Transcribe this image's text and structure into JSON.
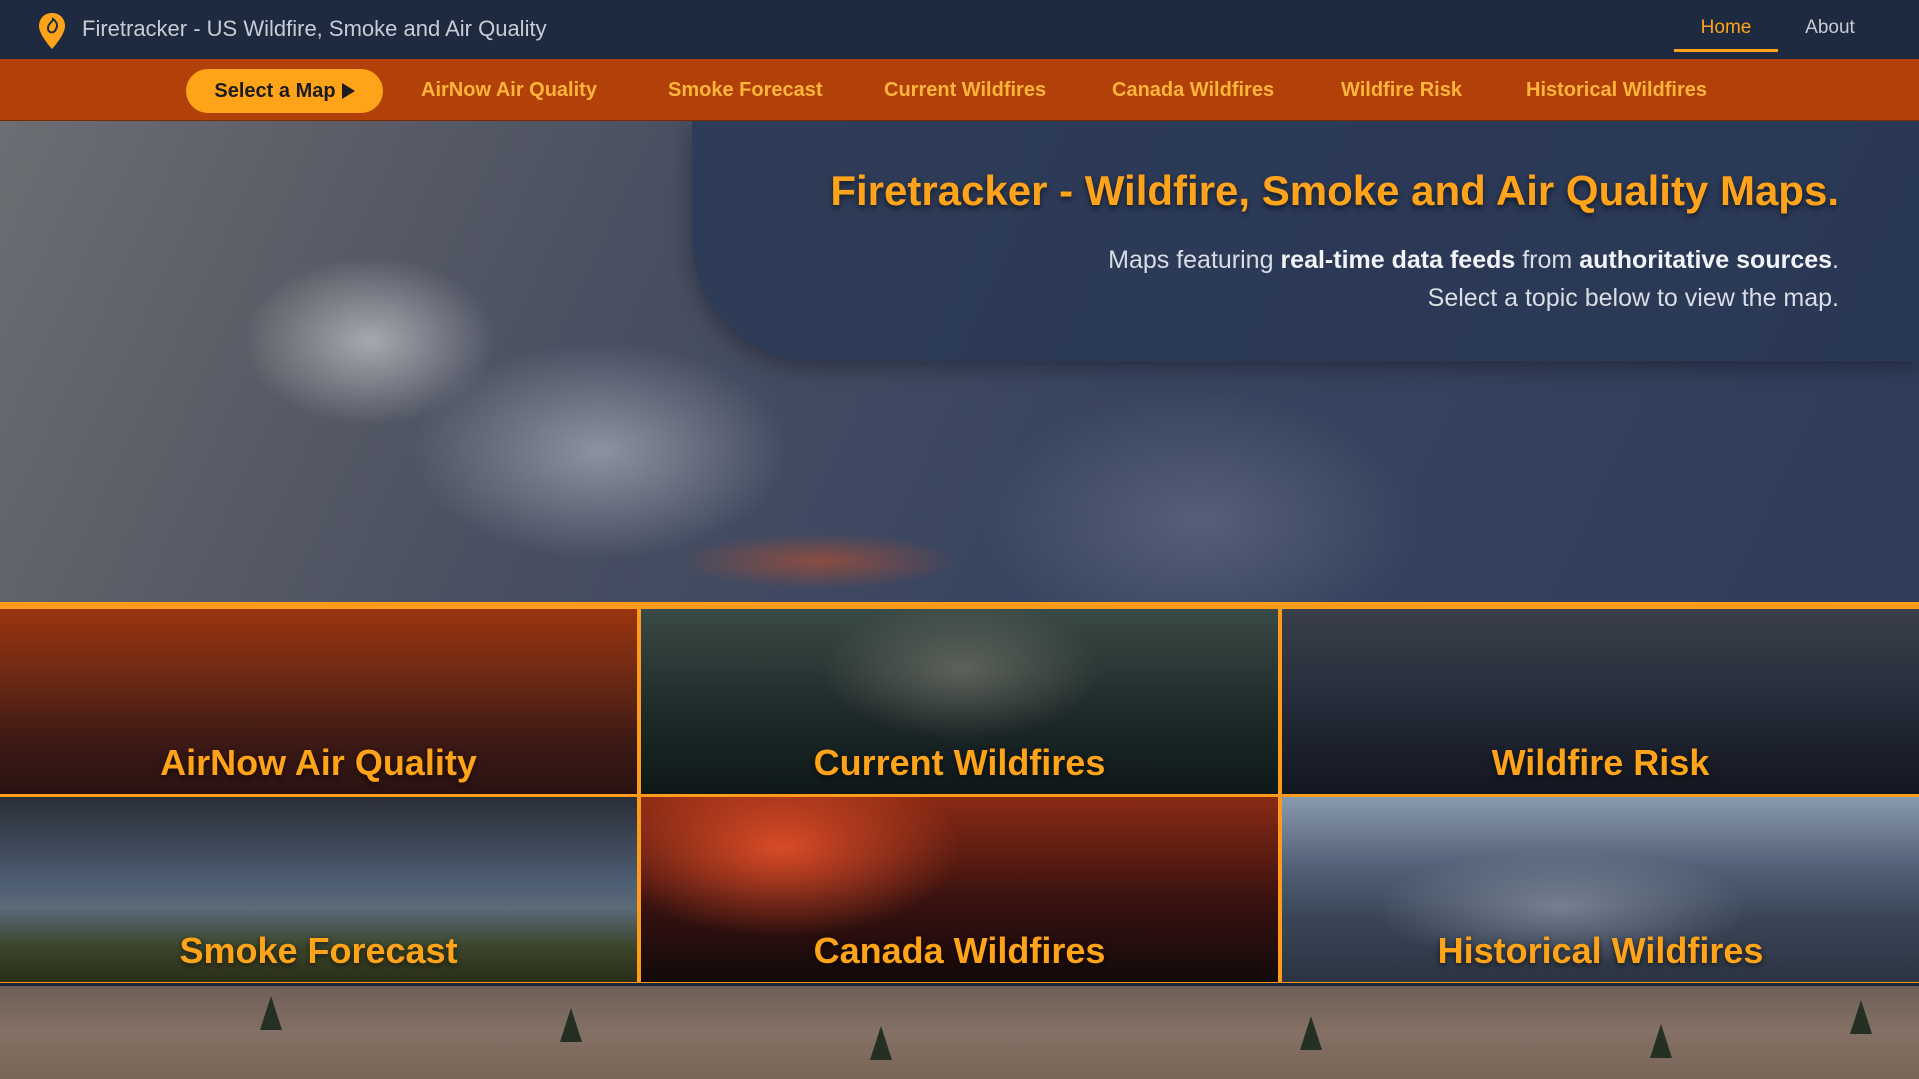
{
  "header": {
    "title": "Firetracker - US Wildfire, Smoke and Air Quality",
    "logo_icon": "flame-pin-icon",
    "nav": [
      {
        "label": "Home",
        "active": true
      },
      {
        "label": "About",
        "active": false
      }
    ]
  },
  "map_nav": {
    "select_label": "Select a Map",
    "links": [
      "AirNow Air Quality",
      "Smoke Forecast",
      "Current Wildfires",
      "Canada Wildfires",
      "Wildfire Risk",
      "Historical Wildfires"
    ]
  },
  "hero": {
    "title": "Firetracker - Wildfire, Smoke and Air Quality Maps.",
    "sub_prefix": "Maps featuring ",
    "sub_bold1": "real-time data feeds",
    "sub_mid": " from ",
    "sub_bold2": "authoritative sources",
    "sub_suffix": ".",
    "sub_line2": "Select a topic below to view the map."
  },
  "tiles": [
    {
      "label": "AirNow Air Quality"
    },
    {
      "label": "Current Wildfires"
    },
    {
      "label": "Wildfire Risk"
    },
    {
      "label": "Smoke Forecast"
    },
    {
      "label": "Canada Wildfires"
    },
    {
      "label": "Historical Wildfires"
    }
  ],
  "colors": {
    "accent": "#ffa31a",
    "header_bg": "#1e2a40",
    "nav_bg": "#b14108"
  }
}
